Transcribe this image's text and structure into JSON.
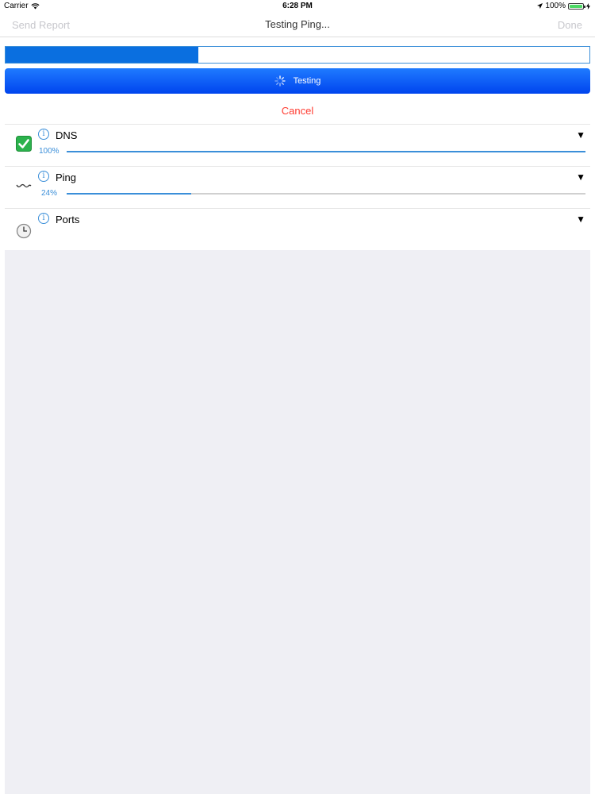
{
  "status_bar": {
    "carrier": "Carrier",
    "time": "6:28 PM",
    "battery": "100%"
  },
  "nav": {
    "left": "Send Report",
    "title": "Testing Ping...",
    "right": "Done"
  },
  "overall_progress": 0.33,
  "testing_button": {
    "label": "Testing"
  },
  "cancel_label": "Cancel",
  "tests": [
    {
      "name": "DNS",
      "status": "complete",
      "status_icon": "checkmark-icon",
      "percent_label": "100%",
      "progress": 1.0
    },
    {
      "name": "Ping",
      "status": "running",
      "status_icon": "wave-icon",
      "percent_label": "24%",
      "progress": 0.24
    },
    {
      "name": "Ports",
      "status": "pending",
      "status_icon": "clock-icon"
    }
  ],
  "colors": {
    "accent": "#3b8fd9",
    "button": "#0a5cff",
    "cancel": "#ff3b30",
    "check": "#2bb24c",
    "background": "#efeff4"
  }
}
